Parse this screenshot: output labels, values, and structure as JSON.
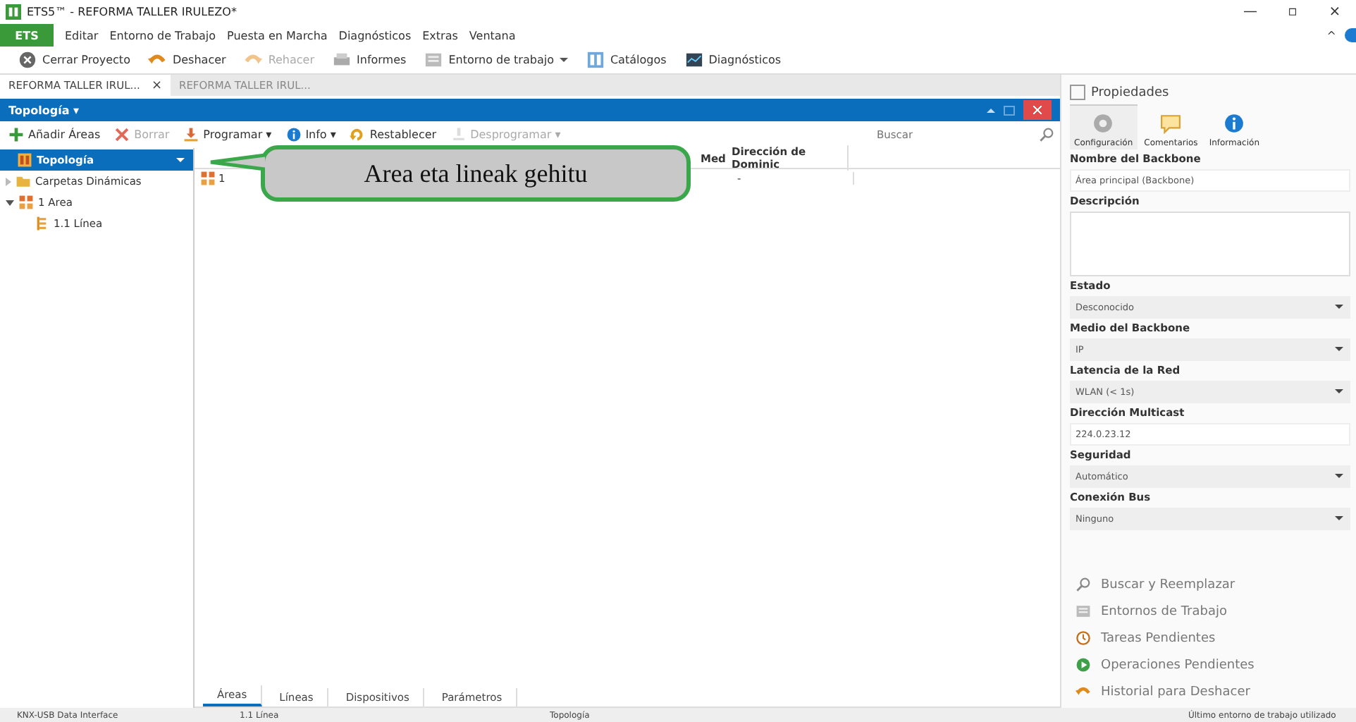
{
  "window": {
    "title": "ETS5™ - REFORMA TALLER IRULEZO*",
    "controls": [
      "—",
      "▫",
      "×"
    ]
  },
  "menu": {
    "app_button": "ETS",
    "items": [
      "Editar",
      "Entorno de Trabajo",
      "Puesta en Marcha",
      "Diagnósticos",
      "Extras",
      "Ventana"
    ],
    "collapse": "^"
  },
  "toolbar": [
    {
      "label": "Cerrar Proyecto",
      "disabled": false,
      "dropdown": false
    },
    {
      "label": "Deshacer",
      "disabled": false,
      "dropdown": false
    },
    {
      "label": "Rehacer",
      "disabled": true,
      "dropdown": false
    },
    {
      "label": "Informes",
      "disabled": false,
      "dropdown": false
    },
    {
      "label": "Entorno de trabajo",
      "disabled": false,
      "dropdown": true
    },
    {
      "label": "Catálogos",
      "disabled": false,
      "dropdown": false
    },
    {
      "label": "Diagnósticos",
      "disabled": false,
      "dropdown": false
    }
  ],
  "doc_tabs": [
    {
      "label": "REFORMA TALLER IRUL...",
      "selected": true,
      "close": "×"
    },
    {
      "label": "REFORMA TALLER IRUL...",
      "selected": false
    }
  ],
  "panel": {
    "title": "Topología ▾",
    "actions": [
      {
        "label": "Añadir Áreas",
        "disabled": false
      },
      {
        "label": "Borrar",
        "disabled": true
      },
      {
        "label": "Programar ▾",
        "disabled": false
      },
      {
        "label": "Info ▾",
        "disabled": false
      },
      {
        "label": "Restablecer",
        "disabled": false
      },
      {
        "label": "Desprogramar ▾",
        "disabled": true
      }
    ],
    "search": {
      "placeholder": "Buscar"
    },
    "tree": [
      {
        "label": "Topología",
        "selected": true
      },
      {
        "label": "Carpetas Dinámicas",
        "selected": false,
        "expanded": false
      },
      {
        "label": "1 Area",
        "selected": false,
        "expanded": true,
        "children": [
          {
            "label": "1.1 Línea",
            "selected": false
          }
        ]
      }
    ],
    "table": {
      "columns": [
        "Med",
        "Dirección de Dominic"
      ],
      "rows": [
        {
          "name": "1",
          "cells": [
            "",
            "-"
          ]
        }
      ]
    },
    "callout": "Area eta lineak gehitu",
    "bottom_tabs": [
      {
        "label": "Áreas",
        "selected": true
      },
      {
        "label": "Líneas",
        "selected": false
      },
      {
        "label": "Dispositivos",
        "selected": false
      },
      {
        "label": "Parámetros",
        "selected": false
      }
    ]
  },
  "properties": {
    "title": "Propiedades",
    "tabs": [
      {
        "label": "Configuración",
        "selected": true
      },
      {
        "label": "Comentarios",
        "selected": false
      },
      {
        "label": "Información",
        "selected": false
      }
    ],
    "fields": [
      {
        "label": "Nombre del Backbone",
        "kind": "text",
        "value": "Área principal (Backbone)"
      },
      {
        "label": "Descripción",
        "kind": "area"
      },
      {
        "label": "Estado",
        "kind": "select",
        "value": "Desconocido"
      },
      {
        "label": "Medio del Backbone",
        "kind": "select",
        "value": "IP"
      },
      {
        "label": "Latencia de la Red",
        "kind": "select",
        "value": "WLAN (< 1s)"
      },
      {
        "label": "Dirección Multicast",
        "kind": "text",
        "value": "224.0.23.12"
      },
      {
        "label": "Seguridad",
        "kind": "select",
        "value": "Automático"
      },
      {
        "label": "Conexión Bus",
        "kind": "select",
        "value": "Ninguno"
      }
    ],
    "links": [
      "Buscar y Reemplazar",
      "Entornos de Trabajo",
      "Tareas Pendientes",
      "Operaciones Pendientes",
      "Historial para Deshacer"
    ]
  },
  "status_bar": [
    "KNX-USB Data Interface",
    "1.1 Línea",
    "Topología",
    "Último entorno de trabajo utilizado"
  ]
}
